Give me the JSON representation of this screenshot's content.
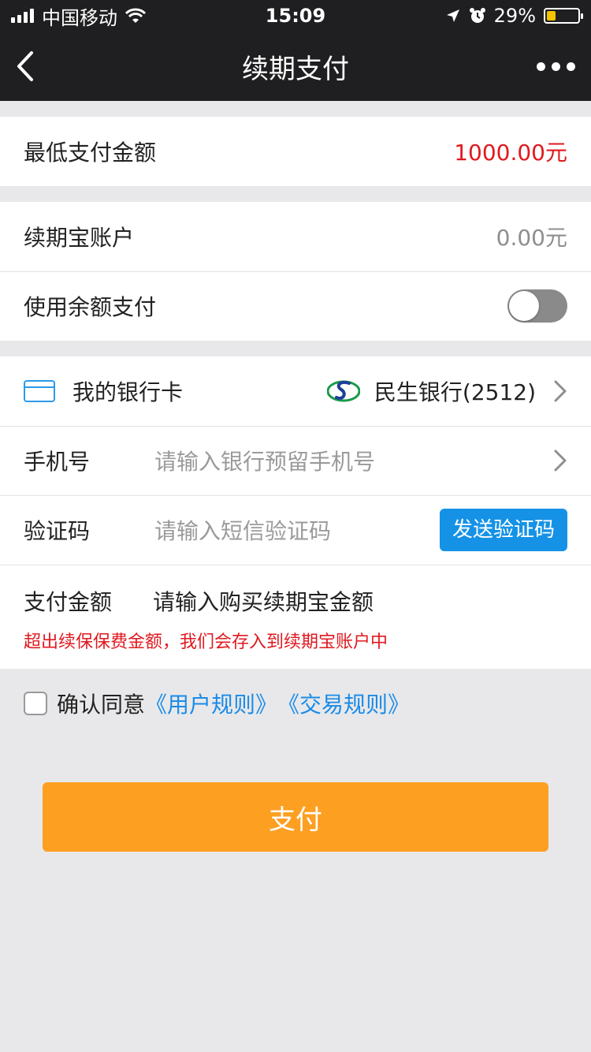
{
  "status_bar": {
    "carrier": "中国移动",
    "time": "15:09",
    "battery": "29%",
    "battery_level": 0.29
  },
  "nav": {
    "title": "续期支付",
    "back_icon": "chevron-left-icon",
    "more_icon": "more-dots-icon"
  },
  "min_payment": {
    "label": "最低支付金额",
    "value": "1000.00元"
  },
  "account": {
    "label": "续期宝账户",
    "value": "0.00元"
  },
  "balance": {
    "label": "使用余额支付",
    "toggle_on": false
  },
  "bank": {
    "label": "我的银行卡",
    "bank_name": "民生银行(2512)"
  },
  "phone": {
    "label": "手机号",
    "placeholder": "请输入银行预留手机号"
  },
  "code": {
    "label": "验证码",
    "placeholder": "请输入短信验证码",
    "send_label": "发送验证码"
  },
  "amount": {
    "label": "支付金额",
    "placeholder": "请输入购买续期宝金额",
    "hint": "超出续保保费金额，我们会存入到续期宝账户中"
  },
  "agreement": {
    "prefix": "确认同意",
    "link1": "《用户规则》",
    "link2": "《交易规则》"
  },
  "pay_button": {
    "label": "支付"
  },
  "colors": {
    "accent_red": "#e0191f",
    "accent_blue": "#1592e6",
    "pay_orange": "#fd9f21",
    "bar_dark": "#1f1f21"
  }
}
